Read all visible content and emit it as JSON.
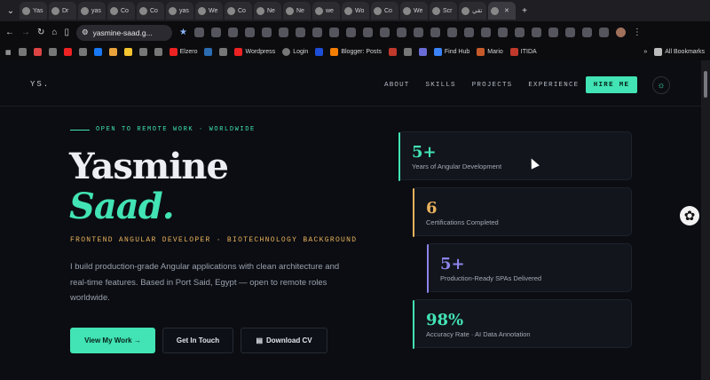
{
  "browser": {
    "tabs": [
      {
        "label": "Yas"
      },
      {
        "label": "Dr"
      },
      {
        "label": "yas"
      },
      {
        "label": "Co"
      },
      {
        "label": "Co"
      },
      {
        "label": "yas"
      },
      {
        "label": "We"
      },
      {
        "label": "Co"
      },
      {
        "label": "Ne"
      },
      {
        "label": "Ne"
      },
      {
        "label": "we"
      },
      {
        "label": "Wo"
      },
      {
        "label": "Co"
      },
      {
        "label": "We"
      },
      {
        "label": "Scr"
      },
      {
        "label": "تقي"
      },
      {
        "label": ""
      }
    ],
    "address": "yasmine-saad.g...",
    "bookmarks": [
      {
        "label": "Elzero"
      },
      {
        "label": "Wordpress"
      },
      {
        "label": "Login"
      },
      {
        "label": "Blogger: Posts"
      },
      {
        "label": "Find Hub"
      },
      {
        "label": "Mario"
      },
      {
        "label": "ITIDA"
      }
    ],
    "all_bookmarks": "All Bookmarks"
  },
  "nav": {
    "logo": "YS.",
    "links": [
      "ABOUT",
      "SKILLS",
      "PROJECTS",
      "EXPERIENCE"
    ],
    "hire": "HIRE ME"
  },
  "hero": {
    "kicker": "OPEN TO REMOTE WORK · WORLDWIDE",
    "first_name": "Yasmine",
    "last_name": "Saad.",
    "role": "FRONTEND ANGULAR DEVELOPER · BIOTECHNOLOGY BACKGROUND",
    "description": "I build production-grade Angular applications with clean architecture and real-time features. Based in Port Said, Egypt — open to remote roles worldwide.",
    "primary_button": "View My Work →",
    "secondary_button": "Get In Touch",
    "cv_button": "Download CV"
  },
  "stats": [
    {
      "value": "5+",
      "label": "Years of Angular Development",
      "color": "#42e3b4"
    },
    {
      "value": "6",
      "label": "Certifications Completed",
      "color": "#e9b25c"
    },
    {
      "value": "5+",
      "label": "Production-Ready SPAs Delivered",
      "color": "#8c84e8"
    },
    {
      "value": "98%",
      "label": "Accuracy Rate · AI Data Annotation",
      "color": "#42e3b4"
    }
  ]
}
